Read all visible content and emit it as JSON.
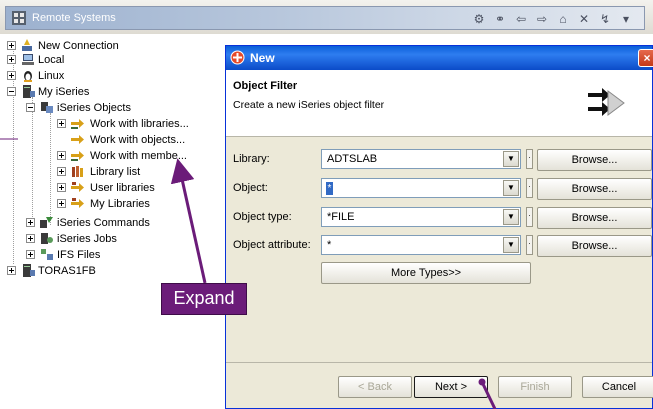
{
  "view": {
    "title": "Remote Systems"
  },
  "tree": {
    "items": [
      {
        "label": "New Connection"
      },
      {
        "label": "Local"
      },
      {
        "label": "Linux"
      },
      {
        "label": "My iSeries"
      },
      {
        "label": "iSeries Objects"
      },
      {
        "label": "Work with libraries..."
      },
      {
        "label": "Work with objects..."
      },
      {
        "label": "Work with membe..."
      },
      {
        "label": "Library list"
      },
      {
        "label": "User libraries"
      },
      {
        "label": "My Libraries"
      },
      {
        "label": "iSeries Commands"
      },
      {
        "label": "iSeries Jobs"
      },
      {
        "label": "IFS Files"
      },
      {
        "label": "TORAS1FB"
      }
    ]
  },
  "dialog": {
    "title": "New",
    "heading": "Object Filter",
    "description": "Create a new iSeries object filter",
    "fields": [
      {
        "label": "Library:",
        "value": "ADTSLAB"
      },
      {
        "label": "Object:",
        "value": ""
      },
      {
        "label": "Object type:",
        "value": "*FILE"
      },
      {
        "label": "Object attribute:",
        "value": "*"
      }
    ],
    "browse_label": "Browse...",
    "more_types_label": "More Types>>",
    "buttons": {
      "back": "< Back",
      "next": "Next >",
      "finish": "Finish",
      "cancel": "Cancel"
    }
  },
  "callout": {
    "label": "Expand"
  },
  "colors": {
    "callout": "#6b1c79",
    "dialog_title": "#0a5fd8",
    "view_title": "#9cb1cf"
  }
}
